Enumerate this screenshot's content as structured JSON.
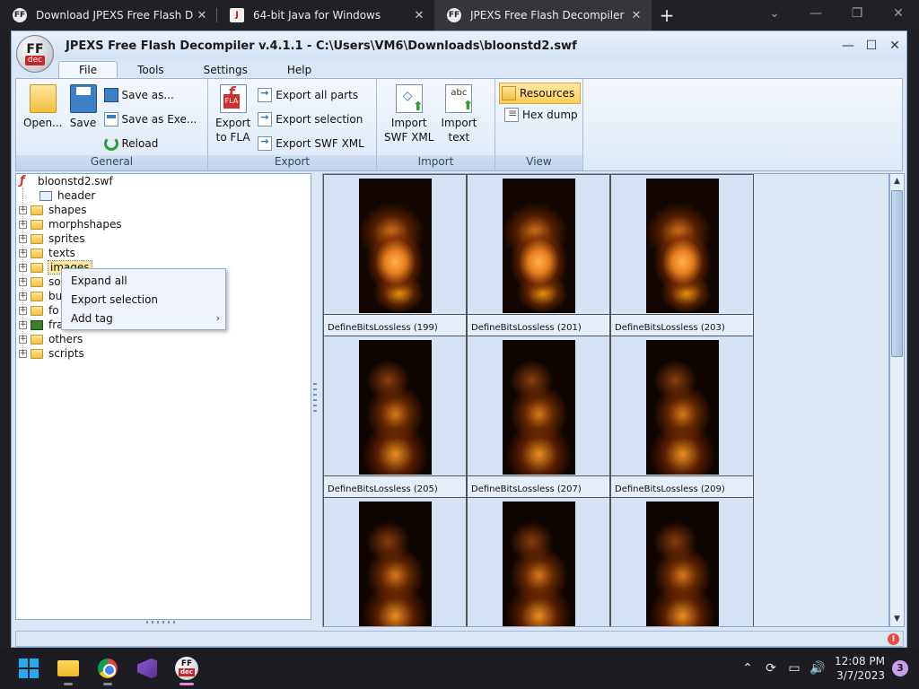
{
  "browser": {
    "tabs": [
      {
        "title": "Download JPEXS Free Flash Deco",
        "favicon": "FF"
      },
      {
        "title": "64-bit Java for Windows",
        "favicon": "J"
      },
      {
        "title": "JPEXS Free Flash Decompiler - De",
        "favicon": "FF"
      }
    ],
    "new_tab": "+",
    "controls": {
      "dropdown": "⌄",
      "minimize": "—",
      "restore": "❐",
      "close": "✕"
    }
  },
  "app": {
    "logo_top": "FF",
    "logo_bottom": "dec",
    "title": "JPEXS Free Flash Decompiler v.4.1.1 - C:\\Users\\VM6\\Downloads\\bloonstd2.swf",
    "controls": {
      "minimize": "—",
      "maximize": "☐",
      "close": "✕"
    }
  },
  "menu": {
    "tabs": [
      "File",
      "Tools",
      "Settings",
      "Help"
    ]
  },
  "ribbon": {
    "general": {
      "label": "General",
      "open": "Open...",
      "save": "Save",
      "save_as": "Save as...",
      "save_as_exe": "Save as Exe...",
      "reload": "Reload"
    },
    "export": {
      "label": "Export",
      "export_fla_line1": "Export",
      "export_fla_line2": "to FLA",
      "export_all_parts": "Export all parts",
      "export_selection": "Export selection",
      "export_swf_xml": "Export SWF XML"
    },
    "import": {
      "label": "Import",
      "import_swf_xml_line1": "Import",
      "import_swf_xml_line2": "SWF XML",
      "import_text_line1": "Import",
      "import_text_line2": "text",
      "text_icon_label": "abc"
    },
    "view": {
      "label": "View",
      "resources": "Resources",
      "hex_dump": "Hex dump"
    }
  },
  "tree": {
    "root": "bloonstd2.swf",
    "items": [
      {
        "label": "header",
        "expandable": false
      },
      {
        "label": "shapes",
        "expandable": true
      },
      {
        "label": "morphshapes",
        "expandable": true
      },
      {
        "label": "sprites",
        "expandable": true
      },
      {
        "label": "texts",
        "expandable": true
      },
      {
        "label": "images",
        "expandable": true
      },
      {
        "label": "so",
        "expandable": true
      },
      {
        "label": "bu",
        "expandable": true
      },
      {
        "label": "fo",
        "expandable": true
      },
      {
        "label": "frames",
        "expandable": true
      },
      {
        "label": "others",
        "expandable": true
      },
      {
        "label": "scripts",
        "expandable": true
      }
    ],
    "expand_glyph": "+"
  },
  "context_menu": {
    "items": [
      "Expand all",
      "Export selection",
      "Add tag"
    ],
    "submenu_glyph": "›"
  },
  "grid": {
    "items": [
      {
        "caption": "DefineBitsLossless (199)"
      },
      {
        "caption": "DefineBitsLossless (201)"
      },
      {
        "caption": "DefineBitsLossless (203)"
      },
      {
        "caption": "DefineBitsLossless (205)"
      },
      {
        "caption": "DefineBitsLossless (207)"
      },
      {
        "caption": "DefineBitsLossless (209)"
      },
      {
        "caption": ""
      },
      {
        "caption": ""
      },
      {
        "caption": ""
      }
    ],
    "scroll_up": "▲",
    "scroll_down": "▼"
  },
  "status": {
    "error_glyph": "!"
  },
  "taskbar": {
    "clock_time": "12:08 PM",
    "clock_date": "3/7/2023",
    "notifications": "3",
    "tray_chevron": "⌃",
    "tray_icons": [
      "⟳",
      "▭",
      "🔊"
    ]
  }
}
